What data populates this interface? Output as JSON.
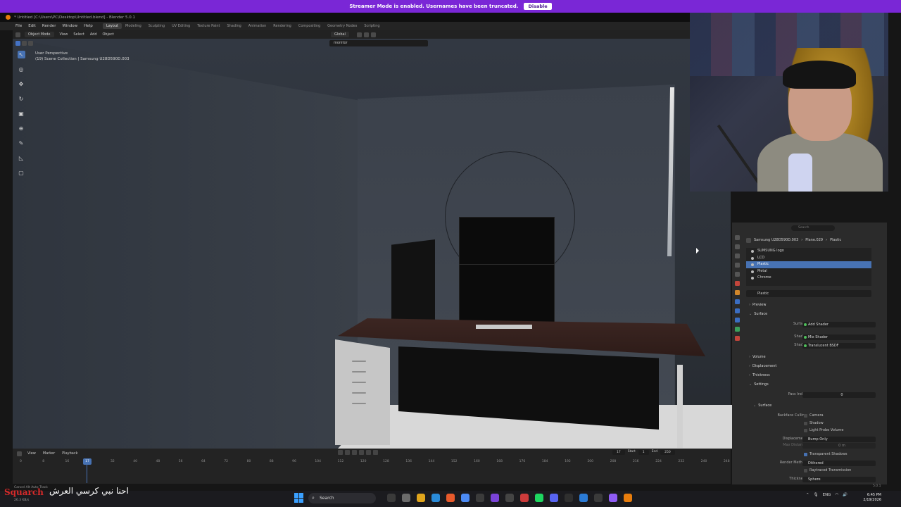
{
  "banner": {
    "message": "Streamer Mode is enabled. Usernames have been truncated.",
    "disable_label": "Disable"
  },
  "window": {
    "title": "* Untitled [C:\\Users\\PC\\Desktop\\Untitled.blend] - Blender 5.0.1"
  },
  "menu": [
    "File",
    "Edit",
    "Render",
    "Window",
    "Help"
  ],
  "workspaces": [
    {
      "label": "Layout",
      "active": true
    },
    {
      "label": "Modeling"
    },
    {
      "label": "Sculpting"
    },
    {
      "label": "UV Editing"
    },
    {
      "label": "Texture Paint"
    },
    {
      "label": "Shading"
    },
    {
      "label": "Animation"
    },
    {
      "label": "Rendering"
    },
    {
      "label": "Compositing"
    },
    {
      "label": "Geometry Nodes"
    },
    {
      "label": "Scripting"
    }
  ],
  "viewport_header": {
    "mode": "Object Mode",
    "items": [
      "View",
      "Select",
      "Add",
      "Object"
    ],
    "orientation": "Global"
  },
  "search": {
    "value": "monitor"
  },
  "viewport_info": {
    "perspective": "User Perspective",
    "collection": "(19) Scene Collection | Samsung U28D590D.003"
  },
  "properties": {
    "search_placeholder": "Search",
    "breadcrumb": {
      "object": "Samsung U28D590D.003",
      "mesh": "Plane.029",
      "material": "Plastic"
    },
    "slots": [
      {
        "label": "SUMSUNG logo"
      },
      {
        "label": "LCD"
      },
      {
        "label": "Plastic",
        "selected": true
      },
      {
        "label": "Metal"
      },
      {
        "label": "Chrome"
      }
    ],
    "material_name": "Plastic",
    "sections": {
      "preview": "Preview",
      "surface": "Surface",
      "volume": "Volume",
      "displacement": "Displacement",
      "thickness": "Thickness",
      "settings": "Settings",
      "surface_sub": "Surface"
    },
    "surface": {
      "surface_label": "Surface",
      "surface_value": "Add Shader",
      "shader1_label": "Shader",
      "shader1_value": "Mix Shader",
      "shader2_label": "Shader",
      "shader2_value": "Translucent BSDF"
    },
    "settings": {
      "pass_index_label": "Pass Index",
      "pass_index_value": "0",
      "backface_label": "Backface Culling",
      "camera_label": "Camera",
      "shadow_label": "Shadow",
      "lightprobe_label": "Light Probe Volume",
      "displacement_label": "Displacement",
      "displacement_value": "Bump Only",
      "max_displacement_label": "Max Distance",
      "max_displacement_value": "0 m",
      "transparent_shadows_label": "Transparent Shadows",
      "render_method_label": "Render Method",
      "render_method_value": "Dithered",
      "raytraced_label": "Raytraced Transmission",
      "thickness_label": "Thickness",
      "thickness_value": "Sphere"
    }
  },
  "timeline": {
    "items": [
      "View",
      "Marker",
      "Playback"
    ],
    "current_frame": "17",
    "start_label": "Start",
    "start": "1",
    "end_label": "End",
    "end": "250",
    "ruler": [
      "0",
      "8",
      "16",
      "24",
      "32",
      "40",
      "48",
      "56",
      "64",
      "72",
      "80",
      "88",
      "96",
      "104",
      "112",
      "120",
      "128",
      "136",
      "144",
      "152",
      "160",
      "168",
      "176",
      "184",
      "192",
      "200",
      "208",
      "216",
      "224",
      "232",
      "240",
      "248"
    ]
  },
  "overlay": {
    "streamer": "Squarch",
    "chat": "احنا نبي كرسي العرش"
  },
  "status": {
    "left": "Cancel   Alt   Auto Track",
    "bytes": "26.3 KB/s",
    "version": "5.0.1"
  },
  "taskbar": {
    "search_label": "Search",
    "lang": "ENG",
    "time": "6:45 PM",
    "date": "2/19/2026"
  },
  "colors": {
    "banner": "#7a27d6",
    "accent": "#4772b3",
    "streamer_name": "#d72a2a"
  }
}
